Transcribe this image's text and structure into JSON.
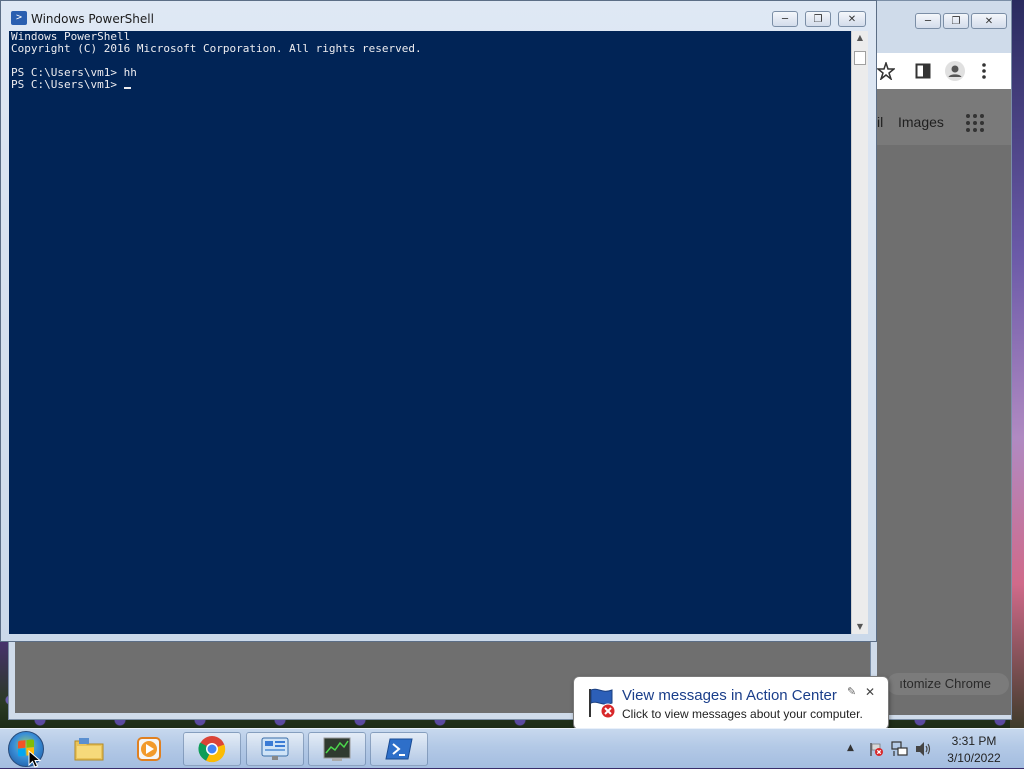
{
  "powershell": {
    "title": "Windows PowerShell",
    "icon": "powershell-icon",
    "lines": [
      "Windows PowerShell",
      "Copyright (C) 2016 Microsoft Corporation. All rights reserved.",
      "",
      "PS C:\\Users\\vm1> hh",
      "PS C:\\Users\\vm1> "
    ],
    "background_color": "#012456",
    "text_color": "#eeedf0"
  },
  "chrome": {
    "nav_partial": "il",
    "images_link": "Images",
    "customize_label": "ıtomize Chrome"
  },
  "balloon": {
    "title": "View messages in Action Center",
    "body": "Click to view messages about your computer.",
    "icon": "action-center-flag-icon"
  },
  "taskbar": {
    "apps": [
      {
        "name": "file-explorer",
        "icon": "folder-icon"
      },
      {
        "name": "media-player",
        "icon": "media-player-icon"
      },
      {
        "name": "google-chrome",
        "icon": "chrome-icon"
      },
      {
        "name": "control-panel",
        "icon": "control-panel-icon"
      },
      {
        "name": "task-manager",
        "icon": "task-manager-icon"
      },
      {
        "name": "windows-powershell",
        "icon": "powershell-icon"
      }
    ],
    "clock_time": "3:31 PM",
    "clock_date": "3/10/2022"
  }
}
